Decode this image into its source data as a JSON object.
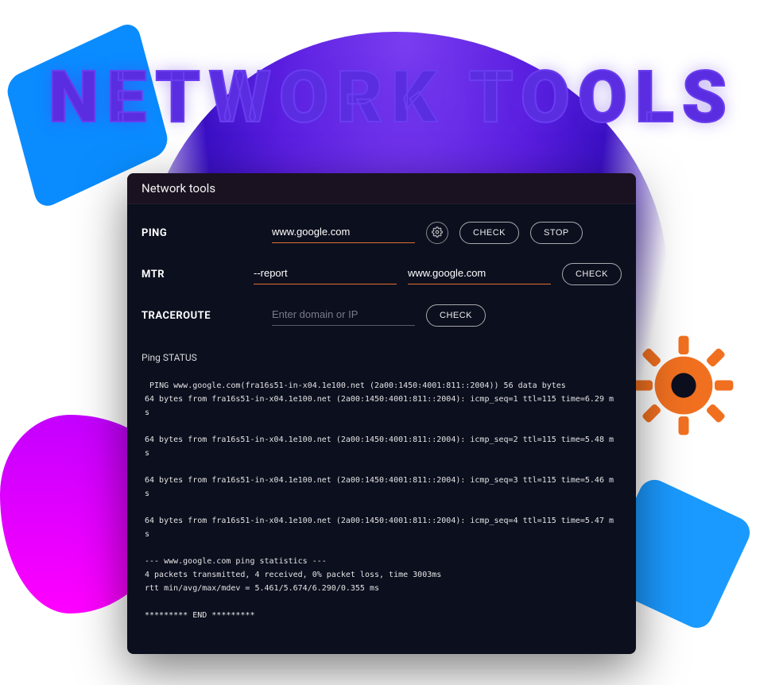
{
  "big_title": "NETWORK\nTOOLS",
  "panel": {
    "title": "Network tools",
    "rows": {
      "ping": {
        "label": "PING",
        "value": "www.google.com",
        "check": "CHECK",
        "stop": "STOP"
      },
      "mtr": {
        "label": "MTR",
        "flags_value": "--report",
        "host_value": "www.google.com",
        "check": "CHECK"
      },
      "traceroute": {
        "label": "TRACEROUTE",
        "placeholder": "Enter domain or IP",
        "check": "CHECK"
      }
    },
    "status_label": "Ping STATUS",
    "terminal": " PING www.google.com(fra16s51-in-x04.1e100.net (2a00:1450:4001:811::2004)) 56 data bytes\n64 bytes from fra16s51-in-x04.1e100.net (2a00:1450:4001:811::2004): icmp_seq=1 ttl=115 time=6.29 ms\n\n64 bytes from fra16s51-in-x04.1e100.net (2a00:1450:4001:811::2004): icmp_seq=2 ttl=115 time=5.48 ms\n\n64 bytes from fra16s51-in-x04.1e100.net (2a00:1450:4001:811::2004): icmp_seq=3 ttl=115 time=5.46 ms\n\n64 bytes from fra16s51-in-x04.1e100.net (2a00:1450:4001:811::2004): icmp_seq=4 ttl=115 time=5.47 ms\n\n--- www.google.com ping statistics ---\n4 packets transmitted, 4 received, 0% packet loss, time 3003ms\nrtt min/avg/max/mdev = 5.461/5.674/6.290/0.355 ms\n\n********* END *********"
  }
}
